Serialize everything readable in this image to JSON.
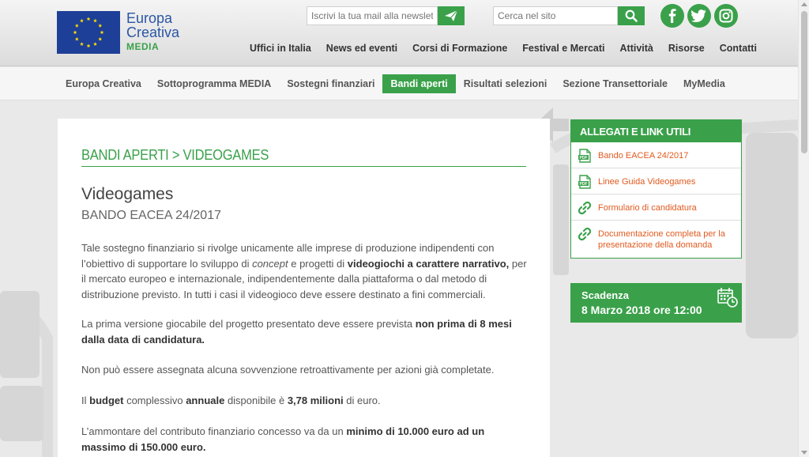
{
  "logo": {
    "line1": "Europa",
    "line2": "Creativa",
    "line3": "MEDIA"
  },
  "newsletter": {
    "placeholder": "Iscrivi la tua mail alla newsletter",
    "button_icon": "send-icon"
  },
  "search": {
    "placeholder": "Cerca nel sito",
    "button_icon": "search-icon"
  },
  "social": [
    "facebook-icon",
    "twitter-icon",
    "instagram-icon"
  ],
  "topnav": [
    "Uffici in Italia",
    "News ed eventi",
    "Corsi di Formazione",
    "Festival e Mercati",
    "Attività",
    "Risorse",
    "Contatti"
  ],
  "mainnav": {
    "items": [
      "Europa Creativa",
      "Sottoprogramma MEDIA",
      "Sostegni finanziari",
      "Bandi aperti",
      "Risultati selezioni",
      "Sezione Transettoriale",
      "MyMedia"
    ],
    "active": "Bandi aperti"
  },
  "content": {
    "breadcrumb": "BANDI APERTI > VIDEOGAMES",
    "title": "Videogames",
    "subtitle": "BANDO EACEA 24/2017",
    "p1": {
      "a": "Tale sostegno finanziario si rivolge unicamente alle imprese di produzione indipendenti con l’obiettivo di supportare lo sviluppo di ",
      "b": "concept",
      "c": " e progetti di ",
      "d": "videogiochi a carattere narrativo,",
      "e": " per il mercato europeo e internazionale, indipendentemente dalla piattaforma o dal metodo di distribuzione previsto. In tutti i casi il videogioco deve essere destinato a fini commerciali."
    },
    "p2": {
      "a": "La prima versione giocabile del progetto presentato deve essere prevista ",
      "b": "non prima di 8 mesi dalla data di candidatura."
    },
    "p3": "Non può essere assegnata alcuna sovvenzione retroattivamente per azioni già completate.",
    "p4": {
      "a": "Il ",
      "b": "budget",
      "c": " complessivo ",
      "d": "annuale",
      "e": " disponibile è ",
      "f": "3,78 milioni",
      "g": " di euro."
    },
    "p5": {
      "a": "L’ammontare del contributo finanziario concesso va da un ",
      "b": "minimo di 10.000 euro ad un massimo di 150.000 euro."
    }
  },
  "sidebar": {
    "header": "ALLEGATI E LINK UTILI",
    "links": [
      {
        "label": "Bando EACEA 24/2017",
        "icon": "pdf-icon"
      },
      {
        "label": "Linee Guida Videogames",
        "icon": "pdf-icon"
      },
      {
        "label": "Formulario di candidatura",
        "icon": "link-icon"
      },
      {
        "label": "Documentazione completa per la presentazione della domanda",
        "icon": "link-icon"
      }
    ],
    "link_color": "#e05a1f"
  },
  "deadline": {
    "label": "Scadenza",
    "value": "8 Marzo 2018 ore 12:00",
    "icon": "calendar-clock-icon"
  },
  "colors": {
    "accent": "#3aa14a",
    "eu_blue": "#1d3f97",
    "logo_text": "#2a56a4"
  }
}
